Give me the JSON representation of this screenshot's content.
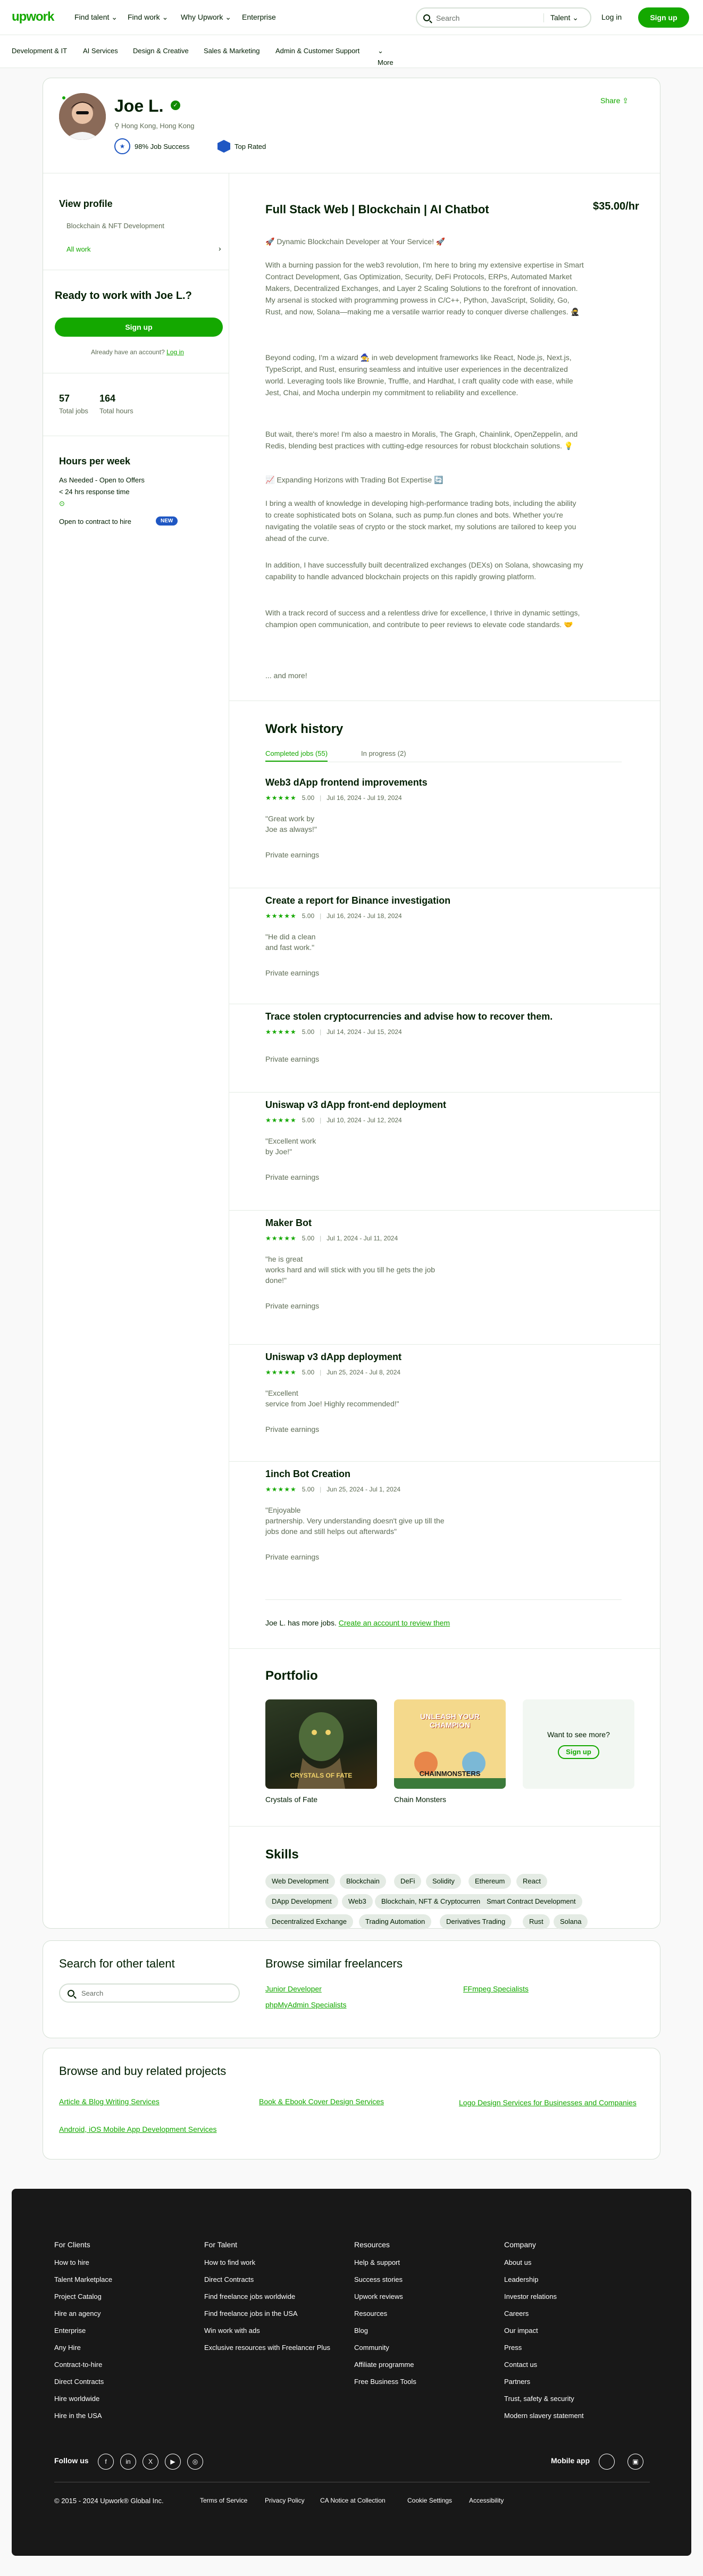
{
  "nav": {
    "logo": "upwork",
    "find_talent": "Find talent",
    "find_work": "Find work",
    "why_upwork": "Why Upwork",
    "enterprise": "Enterprise",
    "search_placeholder": "Search",
    "search_category": "Talent",
    "login": "Log in",
    "signup": "Sign up"
  },
  "subnav": [
    "Development & IT",
    "AI Services",
    "Design & Creative",
    "Sales & Marketing",
    "Admin & Customer Support",
    "More"
  ],
  "profile": {
    "name": "Joe L.",
    "location": "Hong Kong, Hong Kong",
    "job_success": "98% Job Success",
    "top_rated": "Top Rated",
    "share": "Share",
    "view_profile": "View profile",
    "specialty": "Blockchain & NFT Development",
    "all_work": "All work",
    "ready_title": "Ready to work with Joe L.?",
    "signup_btn": "Sign up",
    "already_account": "Already have an account?",
    "login_link": "Log in",
    "total_jobs_value": "57",
    "total_jobs_label": "Total jobs",
    "total_hours_value": "164",
    "total_hours_label": "Total hours",
    "hours_title": "Hours per week",
    "hours_line1": "As Needed - Open to Offers",
    "hours_line2": "< 24 hrs response time",
    "contract_to_hire": "Open to contract to hire",
    "new_badge": "NEW",
    "headline": "Full Stack Web | Blockchain | AI Chatbot",
    "rate": "$35.00/hr"
  },
  "overview": {
    "p1": "🚀 Dynamic Blockchain Developer at Your Service! 🚀",
    "p2": "With a burning passion for the web3 revolution, I'm here to bring my extensive expertise in Smart Contract Development, Gas Optimization, Security, DeFi Protocols, ERPs, Automated Market Makers, Decentralized Exchanges, and Layer 2 Scaling Solutions to the forefront of innovation. My arsenal is stocked with programming prowess in C/C++, Python, JavaScript, Solidity, Go, Rust, and now, Solana—making me a versatile warrior ready to conquer diverse challenges. 🥷",
    "p3": "Beyond coding, I'm a wizard 🧙 in web development frameworks like React, Node.js, Next.js, TypeScript, and Rust, ensuring seamless and intuitive user experiences in the decentralized world. Leveraging tools like Brownie, Truffle, and Hardhat, I craft quality code with ease, while Jest, Chai, and Mocha underpin my commitment to reliability and excellence.",
    "p4": "But wait, there's more! I'm also a maestro in Moralis, The Graph, Chainlink, OpenZeppelin, and Redis, blending best practices with cutting-edge resources for robust blockchain solutions. 💡",
    "p5": "📈 Expanding Horizons with Trading Bot Expertise 🔄",
    "p6": "I bring a wealth of knowledge in developing high-performance trading bots, including the ability to create sophisticated bots on Solana, such as pump.fun clones and bots. Whether you're navigating the volatile seas of crypto or the stock market, my solutions are tailored to keep you ahead of the curve.",
    "p7": "In addition, I have successfully built decentralized exchanges (DEXs) on Solana, showcasing my capability to handle advanced blockchain projects on this rapidly growing platform.",
    "p8": "With a track record of success and a relentless drive for excellence, I thrive in dynamic settings, champion open communication, and contribute to peer reviews to elevate code standards. 🤝",
    "more": "... and more!"
  },
  "work_history": {
    "title": "Work history",
    "tab_completed": "Completed jobs (55)",
    "tab_progress": "In progress (2)",
    "jobs": [
      {
        "title": "Web3 dApp frontend improvements",
        "rating": "5.00",
        "dates": "Jul 16, 2024 - Jul 19, 2024",
        "feedback": "\"Great work by\nJoe as always!\"",
        "earnings": "Private earnings"
      },
      {
        "title": "Create a report for Binance investigation",
        "rating": "5.00",
        "dates": "Jul 16, 2024 - Jul 18, 2024",
        "feedback": "\"He did a clean\nand fast work.\"",
        "earnings": "Private earnings"
      },
      {
        "title": "Trace stolen cryptocurrencies and advise how to recover them.",
        "rating": "5.00",
        "dates": "Jul 14, 2024 - Jul 15, 2024",
        "feedback": "",
        "earnings": "Private earnings"
      },
      {
        "title": "Uniswap v3 dApp front-end deployment",
        "rating": "5.00",
        "dates": "Jul 10, 2024 - Jul 12, 2024",
        "feedback": "\"Excellent work\nby Joe!\"",
        "earnings": "Private earnings"
      },
      {
        "title": "Maker Bot",
        "rating": "5.00",
        "dates": "Jul 1, 2024 - Jul 11, 2024",
        "feedback": "\"he is great\nworks hard and will stick with you till he gets the job\ndone!\"",
        "earnings": "Private earnings"
      },
      {
        "title": "Uniswap v3 dApp deployment",
        "rating": "5.00",
        "dates": "Jun 25, 2024 - Jul 8, 2024",
        "feedback": "\"Excellent\nservice from Joe! Highly recommended!\"",
        "earnings": "Private earnings"
      },
      {
        "title": "1inch Bot Creation",
        "rating": "5.00",
        "dates": "Jun 25, 2024 - Jul 1, 2024",
        "feedback": "\"Enjoyable\npartnership. Very understanding doesn't give up till the\njobs done and still helps out afterwards\"",
        "earnings": "Private earnings"
      }
    ],
    "more_jobs_text": "Joe L. has more jobs.",
    "more_jobs_link": "Create an account to review them"
  },
  "portfolio": {
    "title": "Portfolio",
    "items": [
      {
        "label": "Crystals of Fate"
      },
      {
        "label": "Chain Monsters"
      }
    ],
    "see_more": "Want to see more?",
    "signup": "Sign up",
    "img_text_1": "CRYSTALS OF FATE",
    "img_text_2": "UNLEASH YOUR CHAMPION",
    "img_text_3": "CHAINMONSTERS"
  },
  "skills": {
    "title": "Skills",
    "items": [
      "Web Development",
      "Blockchain",
      "DeFi",
      "Solidity",
      "Ethereum",
      "React",
      "DApp Development",
      "Web3",
      "Blockchain, NFT & Cryptocurrency",
      "Smart Contract Development",
      "Decentralized Exchange",
      "Trading Automation",
      "Derivatives Trading",
      "Rust",
      "Solana"
    ]
  },
  "search_talent": {
    "title": "Search for other talent",
    "placeholder": "Search",
    "similar_title": "Browse similar freelancers",
    "links": [
      "Junior Developer",
      "FFmpeg Specialists",
      "phpMyAdmin Specialists"
    ]
  },
  "related_projects": {
    "title": "Browse and buy related projects",
    "links": [
      "Article & Blog Writing Services",
      "Book & Ebook Cover Design Services",
      "Logo Design Services for Businesses and Companies",
      "Android, iOS Mobile App Development Services"
    ]
  },
  "footer": {
    "columns": [
      {
        "title": "For Clients",
        "links": [
          "How to hire",
          "Talent Marketplace",
          "Project Catalog",
          "Hire an agency",
          "Enterprise",
          "Any Hire",
          "Contract-to-hire",
          "Direct Contracts",
          "Hire worldwide",
          "Hire in the USA"
        ]
      },
      {
        "title": "For Talent",
        "links": [
          "How to find work",
          "Direct Contracts",
          "Find freelance jobs worldwide",
          "Find freelance jobs in the USA",
          "Win work with ads",
          "Exclusive resources with Freelancer Plus"
        ]
      },
      {
        "title": "Resources",
        "links": [
          "Help & support",
          "Success stories",
          "Upwork reviews",
          "Resources",
          "Blog",
          "Community",
          "Affiliate programme",
          "Free Business Tools"
        ]
      },
      {
        "title": "Company",
        "links": [
          "About us",
          "Leadership",
          "Investor relations",
          "Careers",
          "Our impact",
          "Press",
          "Contact us",
          "Partners",
          "Trust, safety & security",
          "Modern slavery statement"
        ]
      }
    ],
    "follow_us": "Follow us",
    "mobile_app": "Mobile app",
    "copyright": "© 2015 - 2024 Upwork® Global Inc.",
    "legal": [
      "Terms of Service",
      "Privacy Policy",
      "CA Notice at Collection",
      "Cookie Settings",
      "Accessibility"
    ],
    "social_icons": [
      "facebook-icon",
      "linkedin-icon",
      "x-icon",
      "youtube-icon",
      "instagram-icon"
    ]
  },
  "colors": {
    "brand": "#14a800",
    "text": "#001e00",
    "footer_bg": "#181818"
  }
}
